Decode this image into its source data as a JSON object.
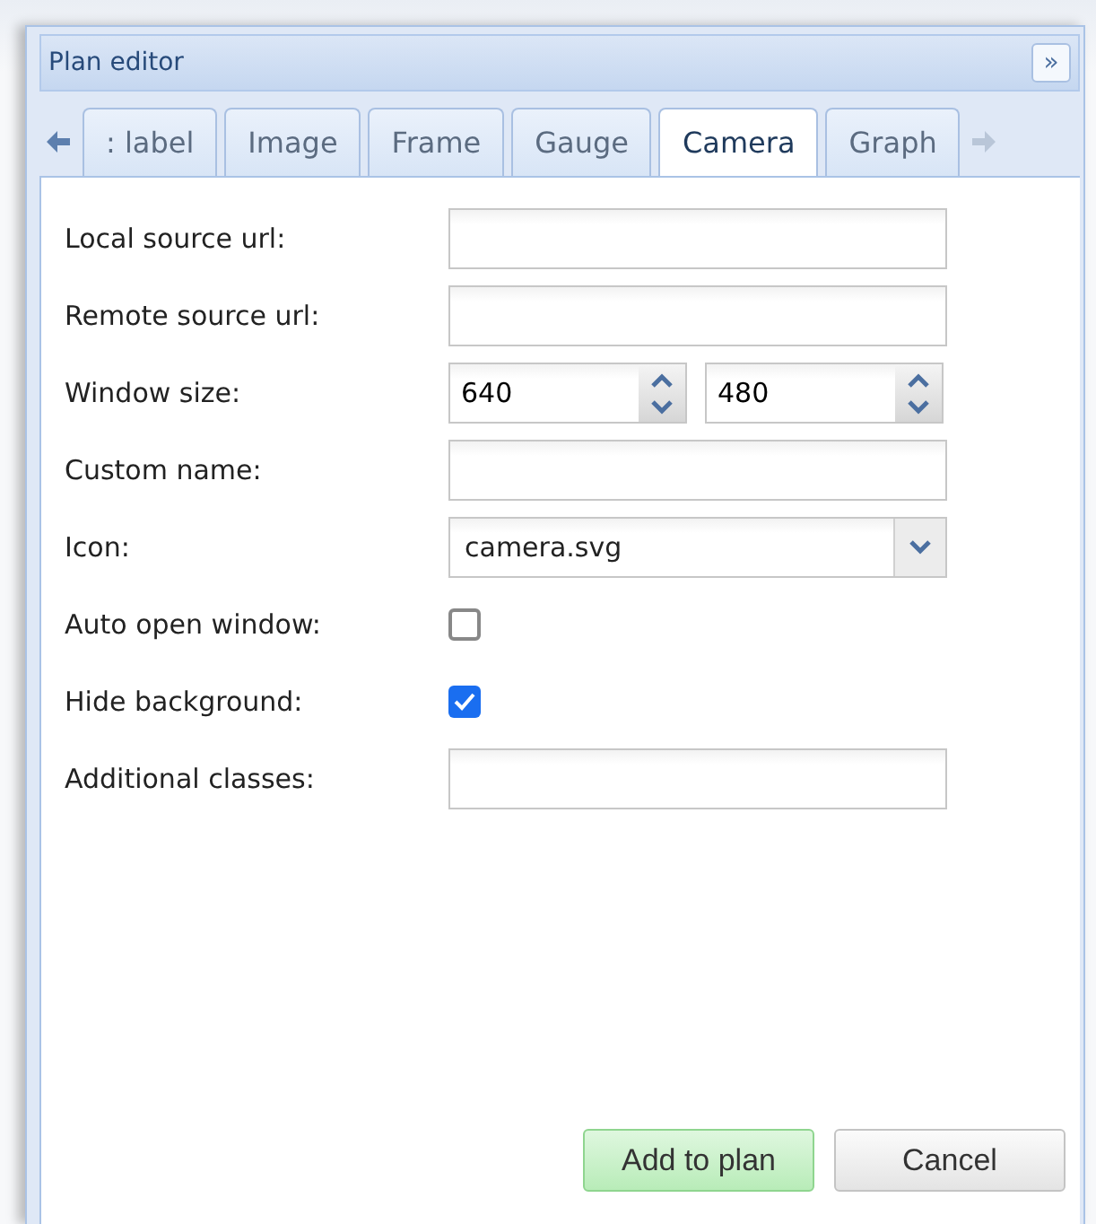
{
  "panel": {
    "title": "Plan editor",
    "collapse_glyph": "»"
  },
  "tabs": [
    {
      "label": ": label",
      "selected": false
    },
    {
      "label": "Image",
      "selected": false
    },
    {
      "label": "Frame",
      "selected": false
    },
    {
      "label": "Gauge",
      "selected": false
    },
    {
      "label": "Camera",
      "selected": true
    },
    {
      "label": "Graph",
      "selected": false
    }
  ],
  "fields": [
    {
      "kind": "text",
      "label": "Local source url:"
    },
    {
      "kind": "text",
      "label": "Remote source url:"
    },
    {
      "kind": "spin",
      "label": "Window size:",
      "values": [
        "640",
        "480"
      ]
    },
    {
      "kind": "text",
      "label": "Custom name:"
    },
    {
      "kind": "select",
      "label": "Icon:",
      "value": "camera.svg"
    },
    {
      "kind": "checkbox",
      "label": "Auto open window:",
      "checked": false
    },
    {
      "kind": "checkbox",
      "label": "Hide background:",
      "checked": true
    },
    {
      "kind": "text",
      "label": "Additional classes:"
    }
  ],
  "buttons": [
    {
      "label": "Add to plan",
      "kind": "primary"
    },
    {
      "label": "Cancel",
      "kind": "plain"
    }
  ]
}
